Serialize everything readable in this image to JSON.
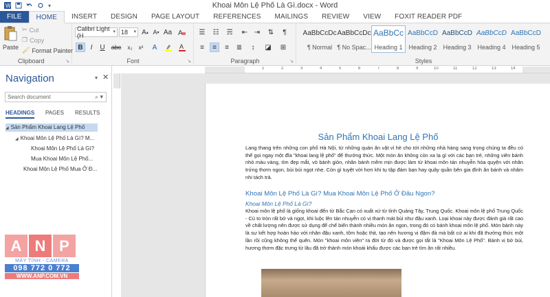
{
  "window": {
    "title": "Khoai Môn Lệ Phố Là Gì.docx - Word"
  },
  "tabs": [
    {
      "label": "FILE"
    },
    {
      "label": "HOME"
    },
    {
      "label": "INSERT"
    },
    {
      "label": "DESIGN"
    },
    {
      "label": "PAGE LAYOUT"
    },
    {
      "label": "REFERENCES"
    },
    {
      "label": "MAILINGS"
    },
    {
      "label": "REVIEW"
    },
    {
      "label": "VIEW"
    },
    {
      "label": "FOXIT READER PDF"
    }
  ],
  "ribbon": {
    "clipboard": {
      "paste": "Paste",
      "cut": "Cut",
      "copy": "Copy",
      "format_painter": "Format Painter",
      "label": "Clipboard"
    },
    "font": {
      "name": "Calibri Light (H",
      "size": "18",
      "label": "Font"
    },
    "paragraph": {
      "label": "Paragraph"
    },
    "styles": {
      "label": "Styles",
      "items": [
        {
          "sample": "AaBbCcDc",
          "name": "¶ Normal"
        },
        {
          "sample": "AaBbCcDc",
          "name": "¶ No Spac..."
        },
        {
          "sample": "AaBbCc",
          "name": "Heading 1"
        },
        {
          "sample": "AaBbCcD",
          "name": "Heading 2"
        },
        {
          "sample": "AaBbCcD",
          "name": "Heading 3"
        },
        {
          "sample": "AaBbCcD",
          "name": "Heading 4"
        },
        {
          "sample": "AaBbCcD",
          "name": "Heading 5"
        }
      ]
    }
  },
  "navigation": {
    "title": "Navigation",
    "search_placeholder": "Search document",
    "tabs": [
      "HEADINGS",
      "PAGES",
      "RESULTS"
    ],
    "headings": [
      "Sản Phẩm Khoai Lang Lệ Phố",
      "Khoai Môn Lệ Phố Là Gì? M...",
      "Khoai Môn Lệ Phố Là Gì?",
      "Mua Khoai Môn Lệ Phố...",
      "Khoai Môn Lệ Phố Mua Ở Đ..."
    ]
  },
  "watermark": {
    "letters": [
      "A",
      "N",
      "P"
    ],
    "subtitle": "MÁY TÍNH - CAMERA",
    "phone": "098 772 0 772",
    "website": "WWW.ANP.COM.VN"
  },
  "ruler": {
    "numbers": [
      "1",
      "2",
      "3",
      "4",
      "5",
      "6",
      "7",
      "8",
      "9",
      "10",
      "11",
      "12",
      "13",
      "14"
    ]
  },
  "document": {
    "title": "Sản Phẩm Khoai Lang Lệ Phố",
    "para1": "Lang thang trên những con phố Hà Nội, từ những quán ăn vặt vỉ hè cho tới những nhà hàng sang trọng chúng ta đều có thể gọi ngay một đĩa \"khoai lang lệ phố\" để thưởng thức. Một món ăn không còn xa lạ gì với các bạn trẻ, những viên bánh nhỏ màu vàng, tím đẹp mắt, vỏ bánh giòn, nhân bánh mềm mịn được làm từ khoai môn tán nhuyễn hòa quyện với nhân trứng thơm ngon, bùi bùi ngọt nhẹ. Còn gì tuyệt vời hơn khi tụ tập đám bạn hay quây quần bên gia đình ăn bánh và nhâm nhi tách trà.",
    "h2": "Khoai Môn Lệ Phố Là Gì? Mua Khoai Môn Lệ Phố Ở Đâu Ngon?",
    "h3": "Khoai Môn Lệ Phố Là Gì?",
    "para2": "Khoai môn lệ phố là giống khoai đến từ Bắc Cạn có xuất xứ từ tỉnh Quảng Tây, Trung Quốc. Khoai môn lệ phố Trung Quốc - Củ to tròn rất bở và ngọt, khi luộc lên tán nhuyễn có vị thanh mát bùi như đậu xanh. Loại khoai này được đánh giá rất cao về chất lượng nên được sử dụng để chế biến thành nhiều món ăn ngon, trong đó có bánh khoai môn lệ phố. Món bánh này là sự kết hợp hoàn hảo với nhân đậu xanh, tôm hoặc thịt, tạo nên hương vị đậm đà mà bất cứ ai khi đã thưởng thức một lần rồi cũng không thể quên. Món \"khoai môn viên\" ra đời từ đó và được gọi tắt là \"Khoai Môn Lệ Phố\". Bánh vị bở bùi, hương thơm đặc trưng từ lâu đã trở thành món khoái khẩu được các bạn trẻ tìm ăn rất nhiều."
  }
}
